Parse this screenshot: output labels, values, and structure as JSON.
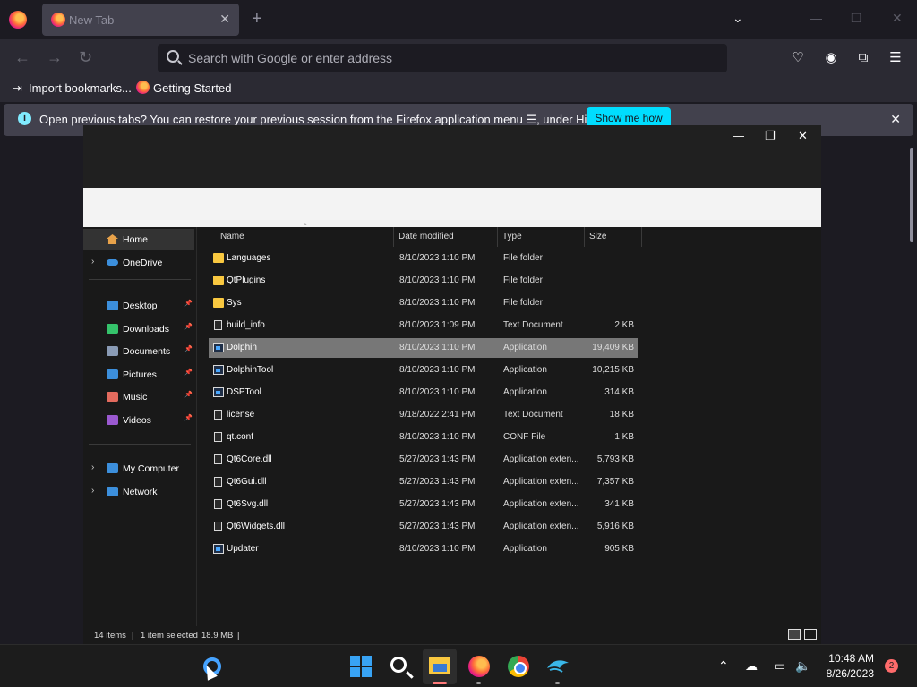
{
  "firefox": {
    "tab_title": "New Tab",
    "new_tab_label": "+",
    "url_placeholder": "Search with Google or enter address",
    "bookmarks": [
      "Import bookmarks...",
      "Getting Started"
    ],
    "notice_text": "Open previous tabs? You can restore your previous session from the Firefox application menu ☰, under History.",
    "notice_button": "Show me how"
  },
  "explorer": {
    "sidebar": {
      "home": "Home",
      "onedrive": "OneDrive",
      "quick": [
        {
          "label": "Desktop",
          "icon": "desktop-icon",
          "color": "#3c8fdc"
        },
        {
          "label": "Downloads",
          "icon": "download-icon",
          "color": "#35c36b"
        },
        {
          "label": "Documents",
          "icon": "documents-icon",
          "color": "#8a9bb5"
        },
        {
          "label": "Pictures",
          "icon": "pictures-icon",
          "color": "#3c8fdc"
        },
        {
          "label": "Music",
          "icon": "music-icon",
          "color": "#e36b5e"
        },
        {
          "label": "Videos",
          "icon": "videos-icon",
          "color": "#9b59d0"
        }
      ],
      "my_computer": "My Computer",
      "network": "Network"
    },
    "columns": [
      "Name",
      "Date modified",
      "Type",
      "Size"
    ],
    "files": [
      {
        "name": "Languages",
        "date": "8/10/2023 1:10 PM",
        "type": "File folder",
        "size": "",
        "kind": "folder"
      },
      {
        "name": "QtPlugins",
        "date": "8/10/2023 1:10 PM",
        "type": "File folder",
        "size": "",
        "kind": "folder"
      },
      {
        "name": "Sys",
        "date": "8/10/2023 1:10 PM",
        "type": "File folder",
        "size": "",
        "kind": "folder"
      },
      {
        "name": "build_info",
        "date": "8/10/2023 1:09 PM",
        "type": "Text Document",
        "size": "2 KB",
        "kind": "doc"
      },
      {
        "name": "Dolphin",
        "date": "8/10/2023 1:10 PM",
        "type": "Application",
        "size": "19,409 KB",
        "kind": "app",
        "selected": true
      },
      {
        "name": "DolphinTool",
        "date": "8/10/2023 1:10 PM",
        "type": "Application",
        "size": "10,215 KB",
        "kind": "app"
      },
      {
        "name": "DSPTool",
        "date": "8/10/2023 1:10 PM",
        "type": "Application",
        "size": "314 KB",
        "kind": "app"
      },
      {
        "name": "license",
        "date": "9/18/2022 2:41 PM",
        "type": "Text Document",
        "size": "18 KB",
        "kind": "doc"
      },
      {
        "name": "qt.conf",
        "date": "8/10/2023 1:10 PM",
        "type": "CONF File",
        "size": "1 KB",
        "kind": "doc"
      },
      {
        "name": "Qt6Core.dll",
        "date": "5/27/2023 1:43 PM",
        "type": "Application exten...",
        "size": "5,793 KB",
        "kind": "doc"
      },
      {
        "name": "Qt6Gui.dll",
        "date": "5/27/2023 1:43 PM",
        "type": "Application exten...",
        "size": "7,357 KB",
        "kind": "doc"
      },
      {
        "name": "Qt6Svg.dll",
        "date": "5/27/2023 1:43 PM",
        "type": "Application exten...",
        "size": "341 KB",
        "kind": "doc"
      },
      {
        "name": "Qt6Widgets.dll",
        "date": "5/27/2023 1:43 PM",
        "type": "Application exten...",
        "size": "5,916 KB",
        "kind": "doc"
      },
      {
        "name": "Updater",
        "date": "8/10/2023 1:10 PM",
        "type": "Application",
        "size": "905 KB",
        "kind": "app"
      }
    ],
    "status": {
      "items": "14 items",
      "selected": "1 item selected",
      "size": "18.9 MB"
    }
  },
  "taskbar": {
    "time": "10:48 AM",
    "date": "8/26/2023",
    "notifications": "2"
  }
}
